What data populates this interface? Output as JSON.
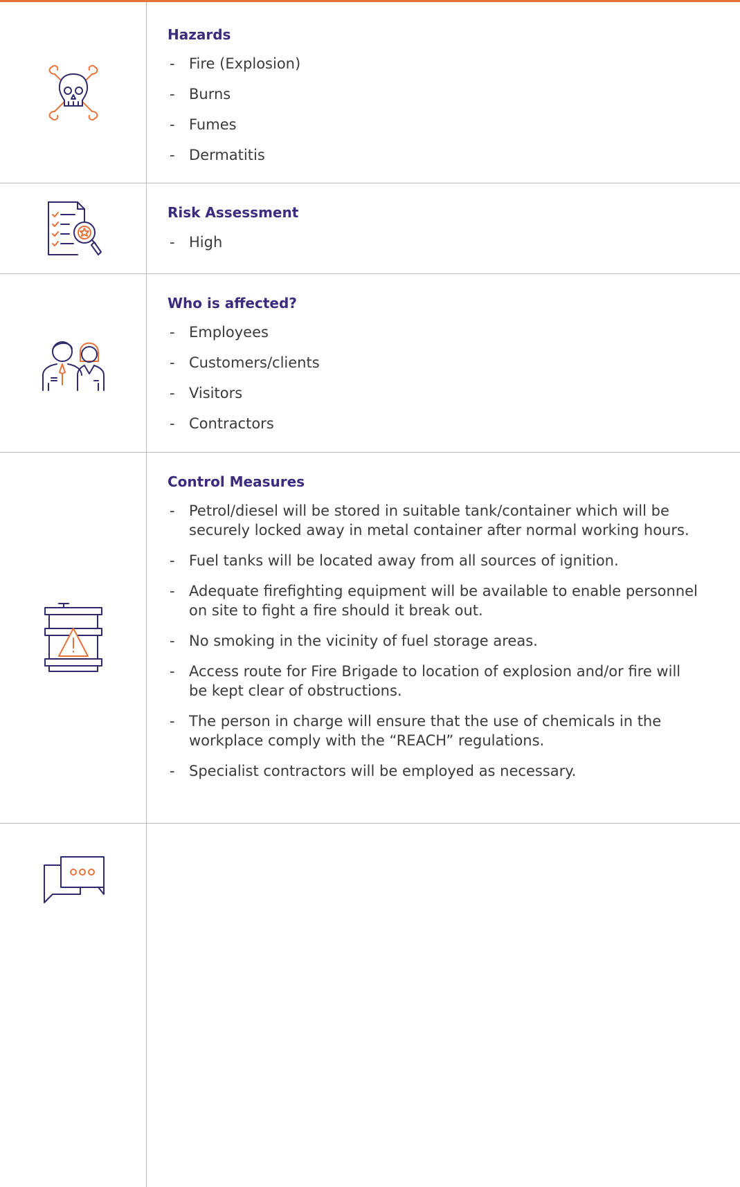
{
  "colors": {
    "accent_orange": "#e8733a",
    "heading_purple": "#3b2a7d",
    "icon_navy": "#2e2a6b",
    "rule_gray": "#b9b9b9",
    "text": "#3a3a3a"
  },
  "sections": [
    {
      "icon": "skull-crossbones-icon",
      "heading": "Hazards",
      "items": [
        "Fire (Explosion)",
        "Burns",
        "Fumes",
        "Dermatitis"
      ]
    },
    {
      "icon": "checklist-magnifier-icon",
      "heading": "Risk Assessment",
      "items": [
        "High"
      ]
    },
    {
      "icon": "people-icon",
      "heading": "Who is affected?",
      "items": [
        "Employees",
        "Customers/clients",
        "Visitors",
        "Contractors"
      ]
    },
    {
      "icon": "fuel-barrel-warning-icon",
      "heading": "Control Measures",
      "items": [
        "Petrol/diesel will be stored in suitable tank/container which will be securely locked away in metal container after normal working hours.",
        "Fuel tanks will be located away from all sources of ignition.",
        "Adequate firefighting equipment will be available to enable personnel on site to fight a fire should it break out.",
        "No smoking in the vicinity of fuel storage areas.",
        "Access route for Fire Brigade to location of explosion and/or fire will be kept clear of obstructions.",
        "The person in charge will ensure that the use of chemicals in the workplace comply with the “REACH” regulations.",
        "Specialist contractors will be employed as necessary."
      ]
    },
    {
      "icon": "chat-bubbles-icon",
      "heading": "",
      "items": []
    }
  ]
}
